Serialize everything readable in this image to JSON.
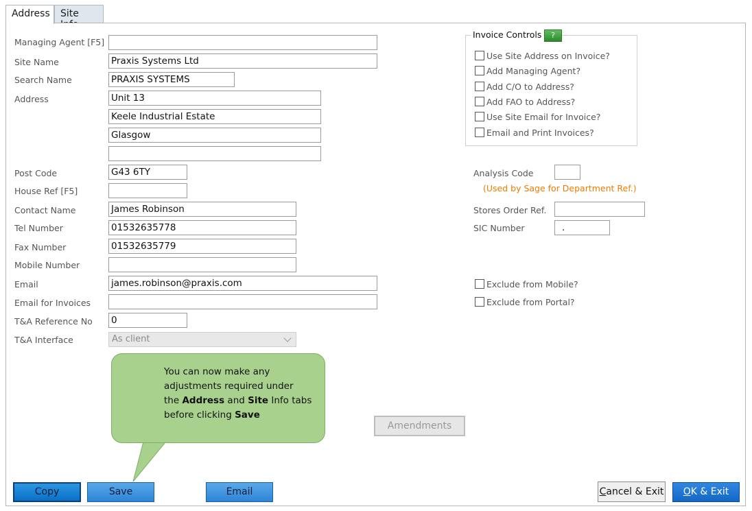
{
  "tabs": [
    {
      "label": "Address",
      "active": true
    },
    {
      "label": "Site Info",
      "active": false
    }
  ],
  "form": {
    "managing_agent": {
      "label": "Managing Agent [F5]",
      "value": ""
    },
    "site_name": {
      "label": "Site Name",
      "value": "Praxis Systems Ltd"
    },
    "search_name": {
      "label": "Search Name",
      "value": "PRAXIS SYSTEMS"
    },
    "address": {
      "label": "Address",
      "line1": "Unit 13",
      "line2": "Keele Industrial Estate",
      "line3": "Glasgow",
      "line4": ""
    },
    "post_code": {
      "label": "Post Code",
      "value": "G43 6TY"
    },
    "house_ref": {
      "label": "House Ref [F5]",
      "value": ""
    },
    "contact_name": {
      "label": "Contact Name",
      "value": "James Robinson"
    },
    "tel_number": {
      "label": "Tel Number",
      "value": "01532635778"
    },
    "fax_number": {
      "label": "Fax Number",
      "value": "01532635779"
    },
    "mobile_number": {
      "label": "Mobile Number",
      "value": ""
    },
    "email": {
      "label": "Email",
      "value": "james.robinson@praxis.com"
    },
    "email_invoices": {
      "label": "Email for Invoices",
      "value": ""
    },
    "ta_ref": {
      "label": "T&A Reference No",
      "value": "0"
    },
    "ta_interface": {
      "label": "T&A Interface",
      "value": "As client"
    }
  },
  "invoice_controls": {
    "title": "Invoice Controls",
    "help_label": "?",
    "options": [
      {
        "label": "Use Site Address on Invoice?",
        "checked": false
      },
      {
        "label": "Add Managing Agent?",
        "checked": false
      },
      {
        "label": "Add C/O to Address?",
        "checked": false
      },
      {
        "label": "Add FAO to Address?",
        "checked": false
      },
      {
        "label": "Use Site Email for Invoice?",
        "checked": false
      },
      {
        "label": "Email and Print Invoices?",
        "checked": false
      }
    ]
  },
  "right": {
    "analysis_code": {
      "label": "Analysis Code",
      "value": "",
      "note": "(Used by Sage for Department Ref.)"
    },
    "stores_order": {
      "label": "Stores Order Ref.",
      "value": ""
    },
    "sic_number": {
      "label": "SIC Number",
      "value": "."
    },
    "exclude_mobile": {
      "label": "Exclude from Mobile?",
      "checked": false
    },
    "exclude_portal": {
      "label": "Exclude from Portal?",
      "checked": false
    }
  },
  "callout": {
    "line1": "You can now make any",
    "line2": "adjustments required under",
    "line3_pre": "the ",
    "line3_b1": "Address",
    "line3_mid": " and ",
    "line3_b2": "Site",
    "line3_post": " Info tabs",
    "line4_pre": "before clicking ",
    "line4_b": "Save"
  },
  "buttons": {
    "amendments": "Amendments",
    "copy": "Copy",
    "save": "Save",
    "email": "Email",
    "cancel_u": "C",
    "cancel_rest": "ancel & Exit",
    "ok_u": "O",
    "ok_rest": "K & Exit"
  },
  "colors": {
    "callout": "#a9d18e",
    "note": "#f07c00",
    "ok_button": "#1567c4"
  }
}
